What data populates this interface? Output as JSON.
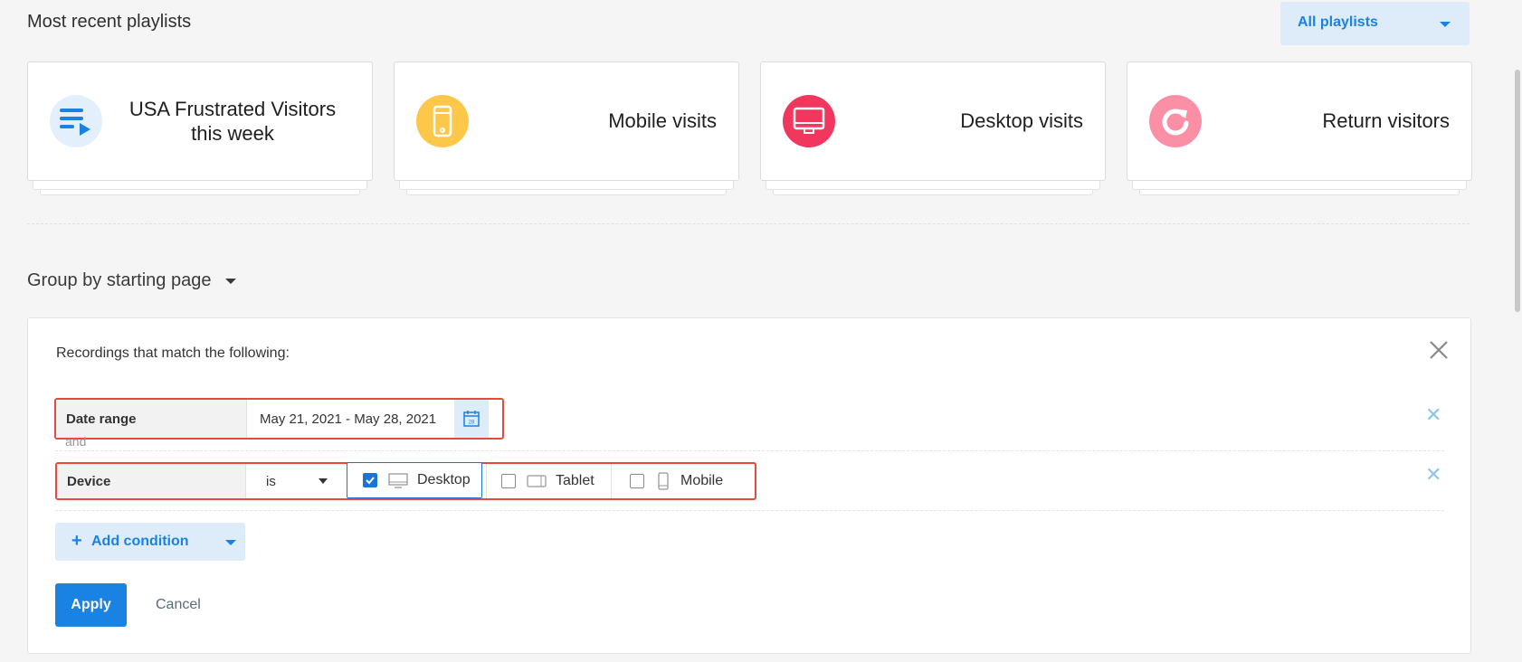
{
  "header": {
    "title": "Most recent playlists",
    "filter_label": "All playlists"
  },
  "playlists": [
    {
      "title_line1": "USA Frustrated Visitors",
      "title_line2": "this week",
      "icon": "playlist-icon",
      "color": "#e3f0fb"
    },
    {
      "title": "Mobile visits",
      "icon": "mobile-icon",
      "color": "#fdc84a"
    },
    {
      "title": "Desktop visits",
      "icon": "desktop-icon",
      "color": "#f2375e"
    },
    {
      "title": "Return visitors",
      "icon": "refresh-icon",
      "color": "#fb8fa6"
    }
  ],
  "group_by": {
    "label": "Group by starting page"
  },
  "filter_panel": {
    "heading": "Recordings that match the following:",
    "conditions": [
      {
        "label": "Date range",
        "value": "May 21, 2021 - May 28, 2021"
      },
      {
        "label": "Device",
        "operator": "is",
        "options": [
          {
            "label": "Desktop",
            "checked": true
          },
          {
            "label": "Tablet",
            "checked": false
          },
          {
            "label": "Mobile",
            "checked": false
          }
        ]
      }
    ],
    "joiner": "and",
    "add_condition_label": "Add condition",
    "apply_label": "Apply",
    "cancel_label": "Cancel"
  },
  "colors": {
    "accent": "#1a82e2",
    "highlight": "#e84a3a"
  }
}
